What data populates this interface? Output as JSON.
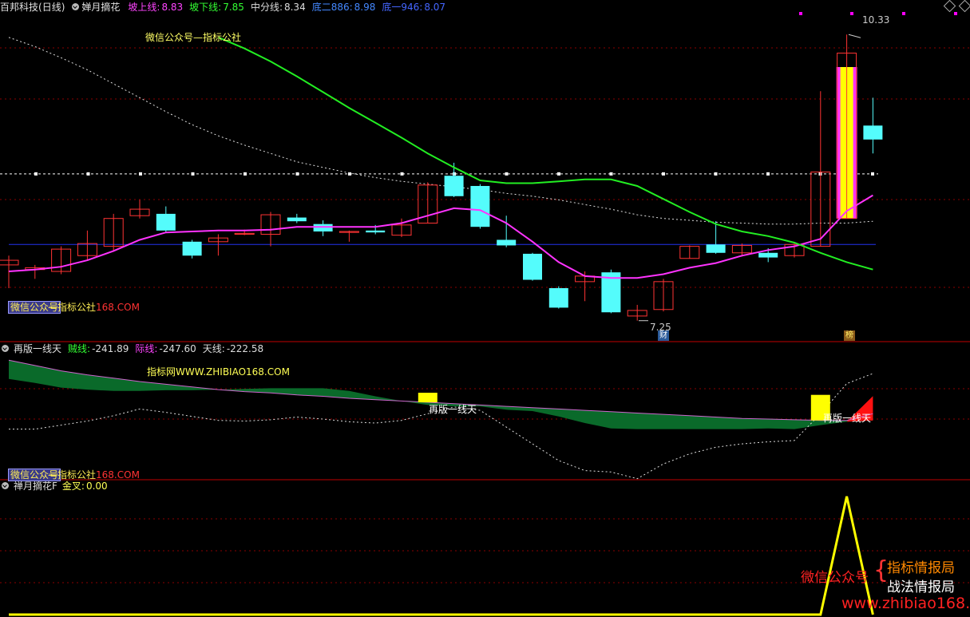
{
  "panel1": {
    "stock_name": "百邦科技",
    "period": "(日线)",
    "indicator": "婵月摘花",
    "metrics": [
      {
        "label": "坡上线:",
        "value": "8.83",
        "label_color": "#ff44ff",
        "value_color": "#ff44ff"
      },
      {
        "label": "坡下线:",
        "value": "7.85",
        "label_color": "#33ff33",
        "value_color": "#33ff33"
      },
      {
        "label": "中分线:",
        "value": "8.34",
        "label_color": "#dddddd",
        "value_color": "#dddddd"
      },
      {
        "label": "底二886:",
        "value": "8.98",
        "label_color": "#4488ff",
        "value_color": "#4488ff"
      },
      {
        "label": "底一946:",
        "value": "8.07",
        "label_color": "#4466ff",
        "value_color": "#4466ff"
      }
    ],
    "watermark_title": "微信公众号—指标公社",
    "watermark_box": "微信公众号",
    "watermark_tail": "—指标公社",
    "watermark_url": "168.COM",
    "high_label": "10.33",
    "low_label": "7.25",
    "badge_cai": "财",
    "badge_bang": "榜"
  },
  "panel2": {
    "title": "再版一线天",
    "metrics": [
      {
        "label": "贼线:",
        "value": "-241.89",
        "color": "#33ff33"
      },
      {
        "label": "际线:",
        "value": "-247.60",
        "color": "#ff44ff"
      },
      {
        "label": "天线:",
        "value": "-222.58",
        "color": "#dddddd"
      }
    ],
    "watermark_site": "指标网WWW.ZHIBIAO168.COM",
    "marker_label_1": "再版一线天",
    "marker_label_2": "再版一线天",
    "watermark_box": "微信公众号",
    "watermark_tail": "—指标公社",
    "watermark_url": "168.COM"
  },
  "panel3": {
    "title": "禅月摘花F",
    "metric_label": "金叉:",
    "metric_value": "0.00",
    "promo_left": "微信公众号",
    "promo_right_1": "指标情报局",
    "promo_right_2": "战法情报局",
    "promo_url": "www.zhibiao168.com"
  },
  "colors": {
    "bull": "#ff3333",
    "bear": "#54fcfc",
    "ma_magenta": "#ff33ff",
    "ma_green": "#22ee22",
    "fill_green": "#0a6a2a",
    "yellow": "#ffff00",
    "grid": "#8b0000"
  },
  "chart_data": {
    "type": "candlestick",
    "candles": [
      {
        "o": 7.85,
        "h": 7.95,
        "l": 7.6,
        "c": 7.9
      },
      {
        "o": 7.8,
        "h": 7.85,
        "l": 7.7,
        "c": 7.82
      },
      {
        "o": 7.78,
        "h": 8.05,
        "l": 7.75,
        "c": 8.02
      },
      {
        "o": 7.95,
        "h": 8.22,
        "l": 7.9,
        "c": 8.08
      },
      {
        "o": 8.05,
        "h": 8.4,
        "l": 8.0,
        "c": 8.35
      },
      {
        "o": 8.38,
        "h": 8.55,
        "l": 8.35,
        "c": 8.45
      },
      {
        "o": 8.4,
        "h": 8.48,
        "l": 8.2,
        "c": 8.22
      },
      {
        "o": 8.1,
        "h": 8.12,
        "l": 7.92,
        "c": 7.95
      },
      {
        "o": 8.1,
        "h": 8.18,
        "l": 7.95,
        "c": 8.14
      },
      {
        "o": 8.18,
        "h": 8.23,
        "l": 8.17,
        "c": 8.19
      },
      {
        "o": 8.18,
        "h": 8.42,
        "l": 8.05,
        "c": 8.39
      },
      {
        "o": 8.36,
        "h": 8.4,
        "l": 8.3,
        "c": 8.32
      },
      {
        "o": 8.29,
        "h": 8.33,
        "l": 8.16,
        "c": 8.21
      },
      {
        "o": 8.2,
        "h": 8.22,
        "l": 8.1,
        "c": 8.21
      },
      {
        "o": 8.22,
        "h": 8.28,
        "l": 8.18,
        "c": 8.2
      },
      {
        "o": 8.17,
        "h": 8.35,
        "l": 8.15,
        "c": 8.28
      },
      {
        "o": 8.3,
        "h": 8.74,
        "l": 8.3,
        "c": 8.71
      },
      {
        "o": 8.81,
        "h": 8.95,
        "l": 8.58,
        "c": 8.59
      },
      {
        "o": 8.7,
        "h": 8.72,
        "l": 8.24,
        "c": 8.26
      },
      {
        "o": 8.12,
        "h": 8.38,
        "l": 8.04,
        "c": 8.06
      },
      {
        "o": 7.97,
        "h": 7.98,
        "l": 7.68,
        "c": 7.69
      },
      {
        "o": 7.6,
        "h": 7.62,
        "l": 7.38,
        "c": 7.39
      },
      {
        "o": 7.67,
        "h": 7.78,
        "l": 7.46,
        "c": 7.73
      },
      {
        "o": 7.77,
        "h": 7.8,
        "l": 7.33,
        "c": 7.34
      },
      {
        "o": 7.3,
        "h": 7.42,
        "l": 7.25,
        "c": 7.36
      },
      {
        "o": 7.37,
        "h": 7.7,
        "l": 7.35,
        "c": 7.67
      },
      {
        "o": 7.92,
        "h": 8.06,
        "l": 7.92,
        "c": 8.05
      },
      {
        "o": 8.07,
        "h": 8.32,
        "l": 7.97,
        "c": 7.98
      },
      {
        "o": 7.98,
        "h": 8.08,
        "l": 7.94,
        "c": 8.06
      },
      {
        "o": 7.98,
        "h": 8.03,
        "l": 7.88,
        "c": 7.93
      },
      {
        "o": 7.95,
        "h": 8.08,
        "l": 7.93,
        "c": 8.07
      },
      {
        "o": 8.05,
        "h": 9.72,
        "l": 8.05,
        "c": 8.85
      },
      {
        "o": 8.35,
        "h": 10.33,
        "l": 8.35,
        "c": 10.13
      },
      {
        "o": 9.35,
        "h": 9.65,
        "l": 9.05,
        "c": 9.2
      }
    ],
    "ma_magenta": [
      7.78,
      7.8,
      7.83,
      7.9,
      8.0,
      8.12,
      8.2,
      8.21,
      8.22,
      8.22,
      8.23,
      8.26,
      8.26,
      8.26,
      8.26,
      8.3,
      8.38,
      8.46,
      8.44,
      8.3,
      8.1,
      7.88,
      7.73,
      7.71,
      7.71,
      7.75,
      7.82,
      7.87,
      7.95,
      8.01,
      8.05,
      8.13,
      8.43,
      8.6
    ],
    "ma_green": [
      null,
      null,
      null,
      null,
      null,
      null,
      null,
      null,
      10.3,
      10.18,
      10.04,
      9.88,
      9.71,
      9.54,
      9.38,
      9.22,
      9.05,
      8.9,
      8.76,
      8.73,
      8.73,
      8.75,
      8.77,
      8.77,
      8.7,
      8.56,
      8.42,
      8.29,
      8.21,
      8.16,
      8.09,
      7.98,
      7.88,
      7.8
    ],
    "ma_dashed": [
      10.3,
      10.2,
      10.08,
      9.95,
      9.8,
      9.65,
      9.5,
      9.36,
      9.24,
      9.14,
      9.05,
      8.96,
      8.9,
      8.84,
      8.79,
      8.75,
      8.72,
      8.69,
      8.66,
      8.62,
      8.59,
      8.55,
      8.5,
      8.45,
      8.39,
      8.35,
      8.33,
      8.31,
      8.3,
      8.29,
      8.29,
      8.3,
      8.3,
      8.32
    ],
    "hline_dotted": 8.83,
    "hline_blue": 8.07,
    "yellow_bar_magenta_bar_index": 32,
    "panel2": {
      "band_top": [
        -180,
        -188,
        -196,
        -202,
        -207,
        -212,
        -216,
        -220,
        -224,
        -227,
        -229,
        -232,
        -234,
        -237,
        -239,
        -241,
        -243,
        -245,
        -247,
        -249,
        -251,
        -253,
        -255,
        -257,
        -259,
        -261,
        -263,
        -265,
        -267,
        -268,
        -269,
        -270,
        -270,
        -260
      ],
      "band_bottom": [
        -208,
        -214,
        -221,
        -224,
        -226,
        -226,
        -225,
        -225,
        -224,
        -223,
        -222,
        -222,
        -222,
        -226,
        -234,
        -241,
        -247,
        -249,
        -249,
        -254,
        -256,
        -264,
        -274,
        -282,
        -283,
        -283,
        -283,
        -283,
        -283,
        -282,
        -283,
        -277,
        -272,
        -270
      ],
      "dashed": [
        -283,
        -283,
        -277,
        -271,
        -263,
        -253,
        -258,
        -264,
        -270,
        -271,
        -269,
        -265,
        -268,
        -272,
        -274,
        -270,
        -260,
        -250,
        -255,
        -280,
        -305,
        -330,
        -345,
        -347,
        -357,
        -335,
        -320,
        -310,
        -305,
        -302,
        -300,
        -260,
        -215,
        -200
      ],
      "markers": [
        16,
        31
      ]
    },
    "panel3": {
      "values": [
        0,
        0,
        0,
        0,
        0,
        0,
        0,
        0,
        0,
        0,
        0,
        0,
        0,
        0,
        0,
        0,
        0,
        0,
        0,
        0,
        0,
        0,
        0,
        0,
        0,
        0,
        0,
        0,
        0,
        0,
        0,
        0,
        1,
        0
      ]
    }
  }
}
